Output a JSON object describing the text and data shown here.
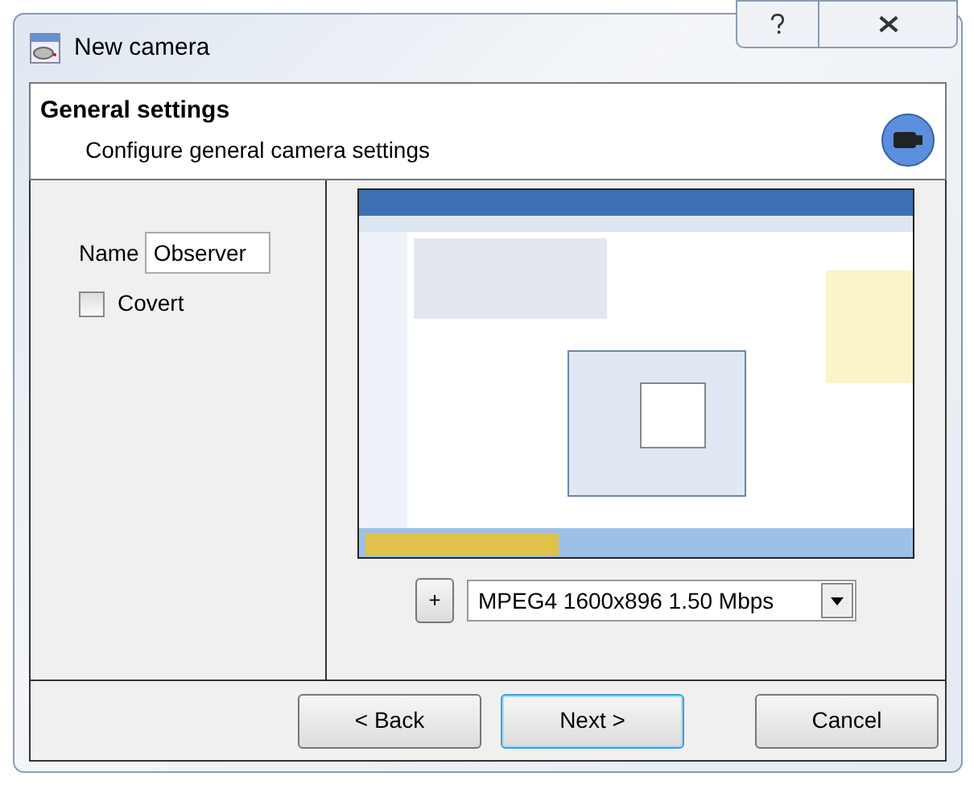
{
  "window": {
    "title": "New camera"
  },
  "header": {
    "title": "General settings",
    "subtitle": "Configure general camera settings"
  },
  "form": {
    "name_label": "Name",
    "name_value": "Observer",
    "covert": {
      "label": "Covert",
      "checked": false
    }
  },
  "stream": {
    "add_button": "+",
    "selected_stream": "MPEG4 1600x896 1.50 Mbps"
  },
  "buttons": [
    {
      "label": "< Back",
      "focused": false
    },
    {
      "label": "Next >",
      "focused": true
    },
    {
      "label": "Cancel",
      "focused": false
    }
  ]
}
